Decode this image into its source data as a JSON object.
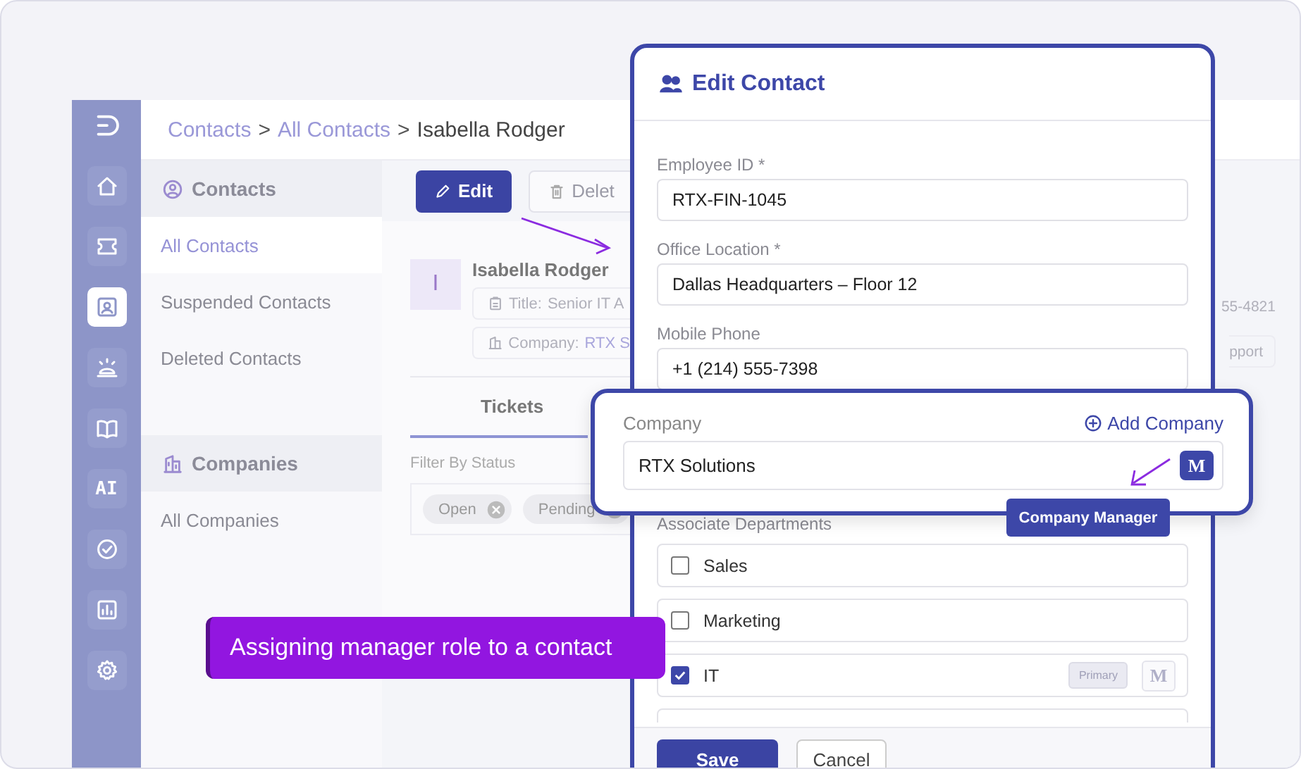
{
  "breadcrumb": {
    "separator": ">",
    "items": [
      {
        "label": "Contacts",
        "current": false
      },
      {
        "label": "All Contacts",
        "current": false
      },
      {
        "label": "Isabella Rodger",
        "current": true
      }
    ]
  },
  "rail": [
    {
      "selected": false
    },
    {
      "selected": false
    },
    {
      "selected": true
    },
    {
      "selected": false
    },
    {
      "selected": false
    },
    {
      "selected": false,
      "label": "AI"
    },
    {
      "selected": false
    },
    {
      "selected": false
    },
    {
      "selected": false
    }
  ],
  "nav": {
    "sections": [
      {
        "title": "Contacts",
        "items": [
          {
            "label": "All Contacts",
            "selected": true
          },
          {
            "label": "Suspended Contacts",
            "selected": false
          },
          {
            "label": "Deleted Contacts",
            "selected": false
          }
        ]
      },
      {
        "title": "Companies",
        "items": [
          {
            "label": "All Companies",
            "selected": false
          }
        ]
      }
    ]
  },
  "toolbar": {
    "buttons": [
      {
        "label": "Edit",
        "kind": "primary"
      },
      {
        "label": "Delet",
        "kind": "secondary"
      }
    ]
  },
  "contact": {
    "initial": "I",
    "name": "Isabella Rodger",
    "chips": [
      {
        "label": "Title:",
        "value": "Senior IT A",
        "link": false
      },
      {
        "label": "Company:",
        "value": "RTX S",
        "link": true
      }
    ]
  },
  "column_3": [
    "55-4821",
    "pport"
  ],
  "tabs": [
    {
      "label": "Tickets",
      "selected": true
    }
  ],
  "filter": {
    "label": "Filter By Status",
    "chips": [
      "Open",
      "Pending"
    ]
  },
  "modal": {
    "title": "Edit Contact",
    "fields": [
      {
        "label": "Employee ID *",
        "value": "RTX-FIN-1045"
      },
      {
        "label": "Office Location *",
        "value": "Dallas Headquarters – Floor 12"
      },
      {
        "label": "Mobile Phone",
        "value": "+1 (214) 555-7398"
      }
    ],
    "departments_label": "Associate Departments",
    "departments": [
      {
        "label": "Sales",
        "checked": false
      },
      {
        "label": "Marketing",
        "checked": false
      },
      {
        "label": "IT",
        "checked": true,
        "primary": "Primary",
        "manager": "M"
      }
    ],
    "buttons": [
      {
        "label": "Save",
        "kind": "primary"
      },
      {
        "label": "Cancel",
        "kind": "secondary"
      }
    ]
  },
  "callout": {
    "label": "Company",
    "action": "Add Company",
    "value": "RTX Solutions",
    "manager_badge": "M",
    "tooltip": "Company Manager"
  },
  "banner": "Assigning manager role to a contact"
}
